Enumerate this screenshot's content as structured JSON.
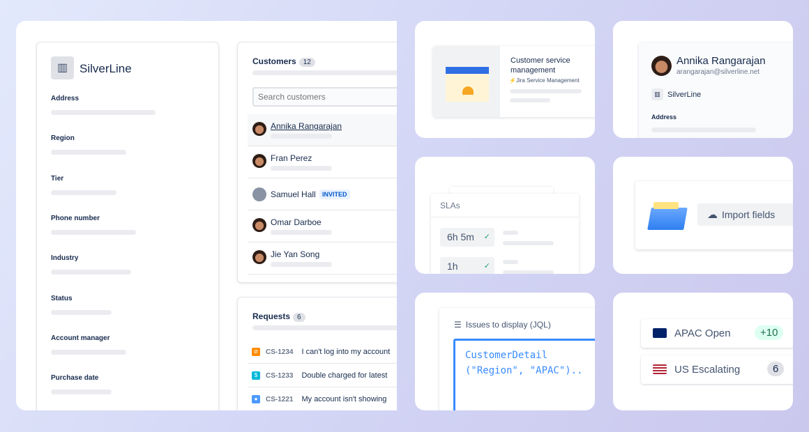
{
  "left_panel": {
    "company": "SilverLine",
    "fields": [
      "Address",
      "Region",
      "Tier",
      "Phone number",
      "Industry",
      "Status",
      "Account manager",
      "Purchase date"
    ]
  },
  "customers": {
    "title": "Customers",
    "count": "12",
    "search_placeholder": "Search customers",
    "items": [
      {
        "name": "Annika Rangarajan",
        "selected": true
      },
      {
        "name": "Fran Perez"
      },
      {
        "name": "Samuel Hall",
        "badge": "INVITED"
      },
      {
        "name": "Omar Darboe"
      },
      {
        "name": "Jie Yan Song"
      }
    ]
  },
  "requests": {
    "title": "Requests",
    "count": "6",
    "items": [
      {
        "key": "CS-1234",
        "summary": "I can't log into my account",
        "icon": "blocked-icon",
        "color": "#ff8b00"
      },
      {
        "key": "CS-1233",
        "summary": "Double charged for latest",
        "icon": "dollar-icon",
        "color": "#00b8d9"
      },
      {
        "key": "CS-1221",
        "summary": "My account isn't showing",
        "icon": "chat-icon",
        "color": "#4c9aff"
      }
    ]
  },
  "tile_csm": {
    "title": "Customer service management",
    "product": "Jira Service Management"
  },
  "tile_profile": {
    "name": "Annika Rangarajan",
    "email": "arangarajan@silverline.net",
    "company": "SilverLine",
    "field": "Address"
  },
  "tile_sla": {
    "title": "SLAs",
    "items": [
      "6h 5m",
      "1h"
    ]
  },
  "tile_import": {
    "button": "Import fields"
  },
  "tile_jql": {
    "label": "Issues to display (JQL)",
    "code_line1": "CustomerDetail",
    "code_line2": "(\"Region\", \"APAC\").."
  },
  "tile_queues": {
    "items": [
      {
        "label": "APAC Open",
        "count": "+10",
        "flag": "australia-flag-icon"
      },
      {
        "label": "US Escalating",
        "count": "6",
        "flag": "us-flag-icon"
      }
    ]
  }
}
